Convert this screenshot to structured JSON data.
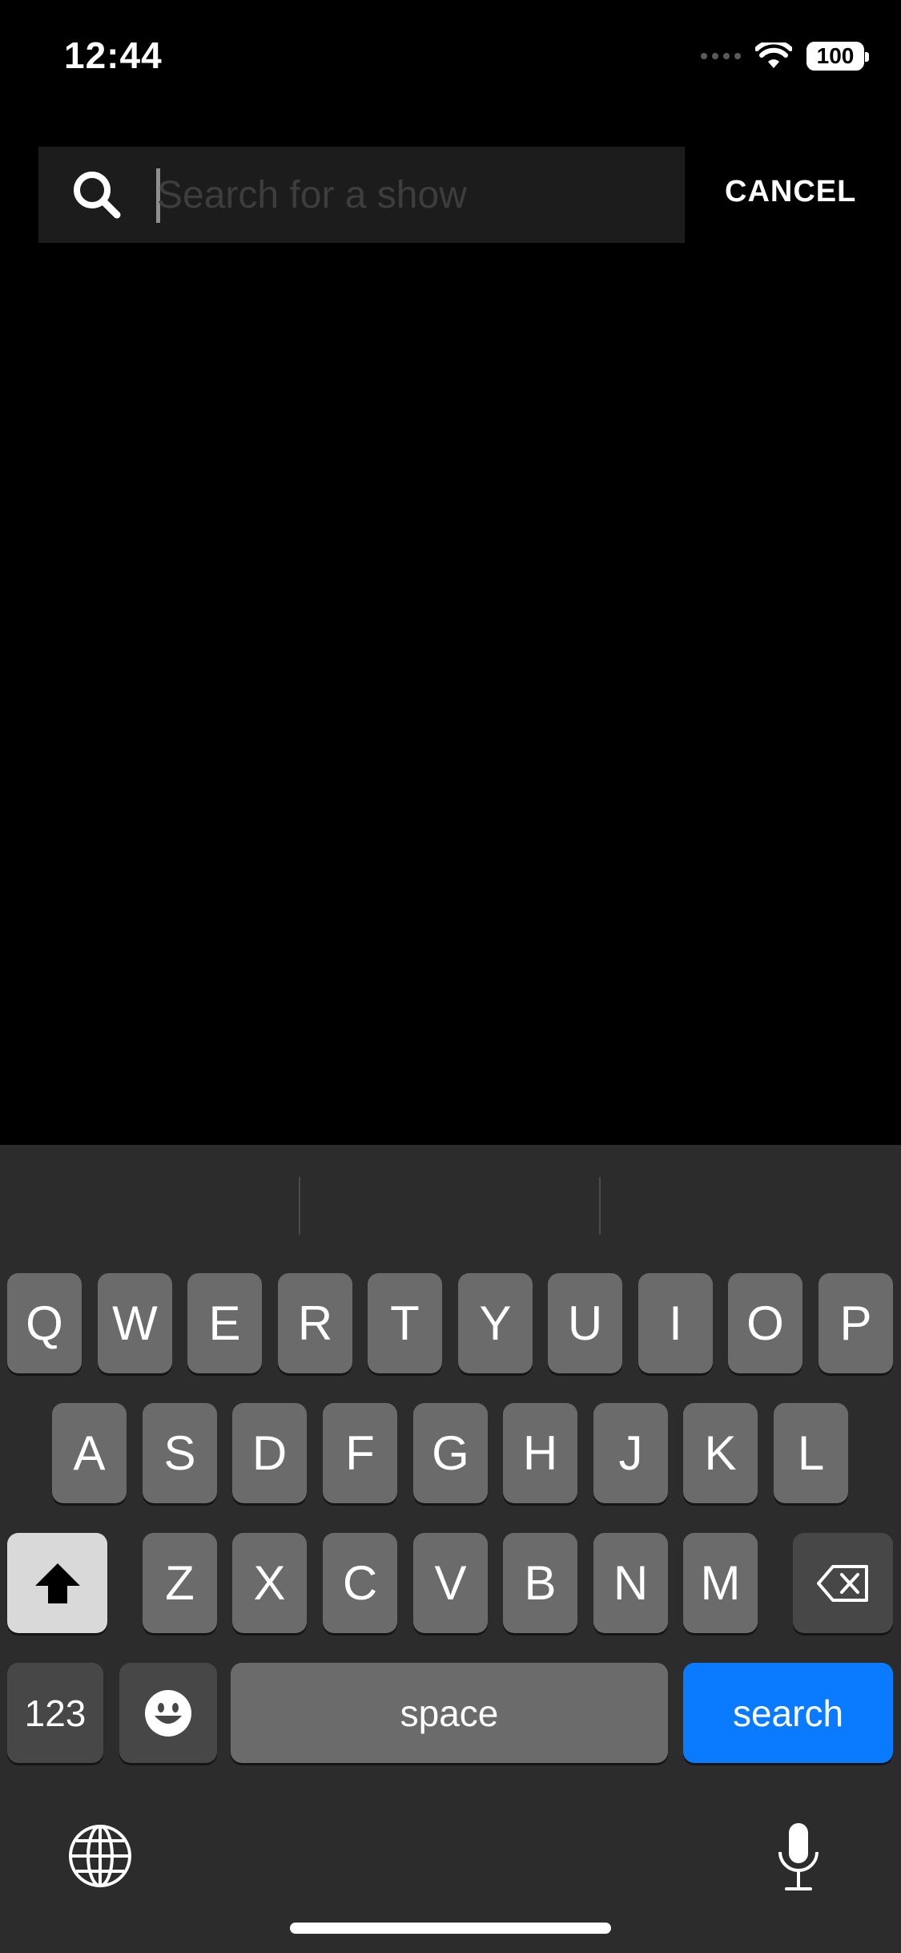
{
  "status_bar": {
    "time": "12:44",
    "battery": "100"
  },
  "search": {
    "placeholder": "Search for a show",
    "value": "",
    "cancel_label": "CANCEL"
  },
  "keyboard": {
    "row1": [
      "Q",
      "W",
      "E",
      "R",
      "T",
      "Y",
      "U",
      "I",
      "O",
      "P"
    ],
    "row2": [
      "A",
      "S",
      "D",
      "F",
      "G",
      "H",
      "J",
      "K",
      "L"
    ],
    "row3": [
      "Z",
      "X",
      "C",
      "V",
      "B",
      "N",
      "M"
    ],
    "numbers_label": "123",
    "space_label": "space",
    "return_label": "search",
    "icons": {
      "shift": "shift-icon",
      "delete": "delete-icon",
      "emoji": "emoji-icon",
      "globe": "globe-icon",
      "mic": "microphone-icon"
    },
    "return_color": "#0a7aff"
  }
}
